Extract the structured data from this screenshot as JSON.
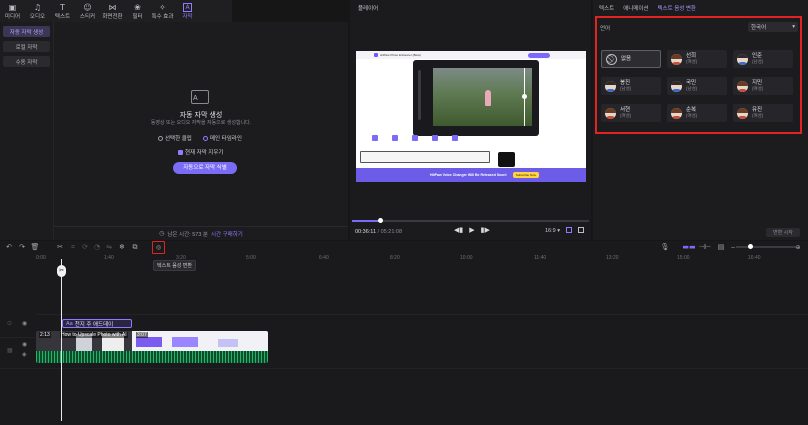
{
  "toolbar": {
    "items": [
      {
        "label": "미디어",
        "icon": "▣"
      },
      {
        "label": "오디오",
        "icon": "♫"
      },
      {
        "label": "텍스트",
        "icon": "T"
      },
      {
        "label": "스티커",
        "icon": "☺"
      },
      {
        "label": "화면전환",
        "icon": "⋈"
      },
      {
        "label": "필터",
        "icon": "❀"
      },
      {
        "label": "특수 효과",
        "icon": "✧"
      },
      {
        "label": "자막",
        "icon": "A"
      }
    ]
  },
  "left_tabs": [
    "자동 자막 생성",
    "로컬 자막",
    "수동 자막"
  ],
  "auto_caption": {
    "icon_text": "A",
    "title": "자동 자막 생성",
    "description": "동영상 또는 오디오 자막을 자동으로 생성합니다.",
    "option_selected_clip": "선택한 클립",
    "option_main_timeline": "메인 타임라인",
    "checkbox_clear": "현재 자막 지우기",
    "start_button": "자동으로 자막 식별",
    "remaining_prefix": "남은 시간: 573 분",
    "buy_link": "시간 구매하기"
  },
  "player": {
    "title": "플레이어",
    "time_current": "00:36:11",
    "time_total": "05:21:08",
    "ratio": "16:9",
    "progress": 0.12,
    "banner_text": "HitPaw Voice Changer Will Be Released Soon!",
    "banner_button": "Subscribe Now",
    "site_name": "HitPaw Photo Enhancer (Beta)"
  },
  "right_panel": {
    "tabs": [
      "텍스트",
      "애니메이션",
      "텍스트 음성 변환"
    ],
    "active_tab": 2,
    "language_label": "언어",
    "language_value": "한국어",
    "voices": [
      {
        "name": "없음",
        "sub": ""
      },
      {
        "name": "선희",
        "sub": "(여성)"
      },
      {
        "name": "인준",
        "sub": "(남성)"
      },
      {
        "name": "봉진",
        "sub": "(남성)"
      },
      {
        "name": "국민",
        "sub": "(남성)"
      },
      {
        "name": "지민",
        "sub": "(여성)"
      },
      {
        "name": "서현",
        "sub": "(여성)"
      },
      {
        "name": "순복",
        "sub": "(여성)"
      },
      {
        "name": "유진",
        "sub": "(여성)"
      }
    ],
    "apply_button": "변환 시작"
  },
  "timeline": {
    "tooltip": "텍스트 음성 변환",
    "ruler": [
      "0:00",
      "1:40",
      "3:20",
      "5:00",
      "6:40",
      "8:20",
      "10:00",
      "11:40",
      "13:20",
      "15:00",
      "16:40"
    ],
    "text_clip": "천지 주 애드데이",
    "clip1_time": "2:13",
    "clip1_label": "How to Upscale Photo with AI",
    "clip2_time": "3:07",
    "accent": "#7b6cf6",
    "audio_color": "#16a05a",
    "highlight_color": "#e02424"
  }
}
